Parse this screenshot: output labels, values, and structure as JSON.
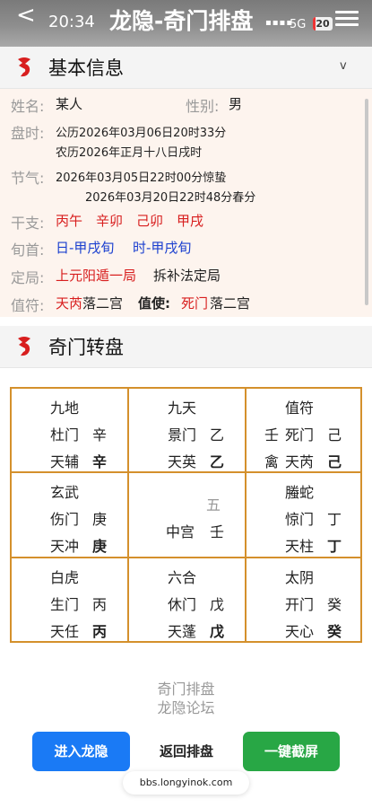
{
  "status_bar": {
    "back": "<",
    "time": "20:34",
    "title": "龙隐-奇门排盘",
    "network": "5G",
    "battery": "20"
  },
  "basic_info": {
    "title": "基本信息",
    "collapse": "v",
    "name_label": "姓名:",
    "name": "某人",
    "gender_label": "性别:",
    "gender": "男",
    "time_label": "盘时:",
    "solar": "公历2026年03月06日20时33分",
    "lunar": "农历2026年正月十八日戌时",
    "term_label": "节气:",
    "term1": "2026年03月05日22时00分惊蛰",
    "term2": "2026年03月20日22时48分春分",
    "ganzhi_label": "干支:",
    "ganzhi": [
      "丙午",
      "辛卯",
      "己卯",
      "甲戌"
    ],
    "xunshou_label": "旬首:",
    "xunshou": [
      "日-甲戌旬",
      "时-甲戌旬"
    ],
    "ju_label": "定局:",
    "ju": "上元阳遁一局",
    "ju_method": "拆补法定局",
    "zhifu_label": "值符:",
    "zhifu_star": "天芮",
    "zhifu_palace": "落二宫",
    "zhishi_label": "值使:",
    "zhishi_door": "死门",
    "zhishi_palace": "落二宫"
  },
  "chart_section": {
    "title": "奇门转盘"
  },
  "palaces": [
    {
      "god": "九地",
      "door": "杜门",
      "door_stem": "辛",
      "star": "天辅",
      "star_stem": "辛",
      "extra": ""
    },
    {
      "god": "九天",
      "door": "景门",
      "door_stem": "乙",
      "star": "天英",
      "star_stem": "乙",
      "extra": ""
    },
    {
      "god": "值符",
      "door": "死门",
      "door_stem": "己",
      "star": "天芮",
      "star_stem": "己",
      "extra": "壬",
      "extra2": "禽"
    },
    {
      "god": "玄武",
      "door": "伤门",
      "door_stem": "庚",
      "star": "天冲",
      "star_stem": "庚",
      "extra": ""
    },
    {
      "god": "五",
      "door": "中宫",
      "door_stem": "壬",
      "star": "",
      "star_stem": "",
      "extra": ""
    },
    {
      "god": "螣蛇",
      "door": "惊门",
      "door_stem": "丁",
      "star": "天柱",
      "star_stem": "丁",
      "extra": ""
    },
    {
      "god": "白虎",
      "door": "生门",
      "door_stem": "丙",
      "star": "天任",
      "star_stem": "丙",
      "extra": ""
    },
    {
      "god": "六合",
      "door": "休门",
      "door_stem": "戊",
      "star": "天蓬",
      "star_stem": "戊",
      "extra": ""
    },
    {
      "god": "太阴",
      "door": "开门",
      "door_stem": "癸",
      "star": "天心",
      "star_stem": "癸",
      "extra": ""
    }
  ],
  "footer": {
    "line1": "奇门排盘",
    "line2": "龙隐论坛",
    "btn_enter": "进入龙隐",
    "btn_back": "返回排盘",
    "btn_shot": "一键截屏",
    "url": "bbs.longyinok.com"
  },
  "colors": {
    "accent_red": "#d81e1e",
    "accent_blue": "#1a3fcf",
    "grid_border": "#d4902c",
    "info_bg": "#fdf4ee"
  },
  "icons": [
    "dragon-logo-icon",
    "menu-icon",
    "signal-icon"
  ]
}
